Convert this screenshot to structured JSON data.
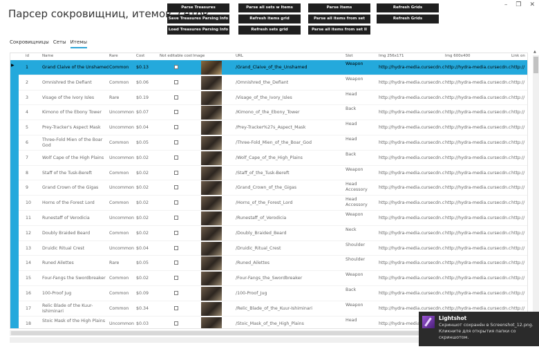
{
  "window": {
    "title": "Парсер сокровищниц, итемов, сетов",
    "min": "–",
    "max": "❐",
    "close": "✕"
  },
  "buttons": {
    "parse_treasures": "Parse Treasures",
    "save_treasures": "Save Treasures Parsing Info",
    "load_treasures": "Load Treasures Parsing Info",
    "parse_sets": "Parse all sets w Items",
    "refresh_items": "Refresh items grid",
    "refresh_sets": "Refresh sets grid",
    "parse_items": "Parse Items",
    "parse_all_from_set": "Parse all items from set",
    "parse_all_from_set2": "Parse all items from set II",
    "refresh_grids": "Refresh Grids",
    "refresh_grids2": "Refresh Grids"
  },
  "tabs": [
    "Сокровищницы",
    "Сеты",
    "Итемы"
  ],
  "columns": [
    "id",
    "Name",
    "Rare",
    "Cost",
    "Not editable cost",
    "Image",
    "URL",
    "Slot",
    "Img 256x171",
    "Img 600x400",
    "Link on"
  ],
  "rows": [
    {
      "id": "1",
      "name": "Grand Claive of the Unshamed",
      "rare": "Common",
      "cost": "$0.13",
      "url": "/Grand_Claive_of_the_Unshamed",
      "slot": "Weapon",
      "img256": "http://hydra-media.cursecdn.com",
      "img600": "http://hydra-media.cursecdn.com",
      "link": "http://"
    },
    {
      "id": "2",
      "name": "Omnishred the Defiant",
      "rare": "Common",
      "cost": "$0.06",
      "url": "/Omnishred_the_Defiant",
      "slot": "Weapon",
      "img256": "http://hydra-media.cursecdn.cor",
      "img600": "http://hydra-media.cursecdn.cor",
      "link": "http://"
    },
    {
      "id": "3",
      "name": "Visage of the Ivory Isles",
      "rare": "Rare",
      "cost": "$0.19",
      "url": "/Visage_of_the_Ivory_Isles",
      "slot": "Head",
      "img256": "http://hydra-media.cursecdn.cor",
      "img600": "http://hydra-media.cursecdn.cor",
      "link": "http://"
    },
    {
      "id": "4",
      "name": "Kimono of the Ebony Tower",
      "rare": "Uncommon",
      "cost": "$0.07",
      "url": "/Kimono_of_the_Ebony_Tower",
      "slot": "Back",
      "img256": "http://hydra-media.cursecdn.cor",
      "img600": "http://hydra-media.cursecdn.cor",
      "link": "http://"
    },
    {
      "id": "5",
      "name": "Prey-Tracker's Aspect Mask",
      "rare": "Uncommon",
      "cost": "$0.04",
      "url": "/Prey-Tracker%27s_Aspect_Mask",
      "slot": "Head",
      "img256": "http://hydra-media.cursecdn.cor",
      "img600": "http://hydra-media.cursecdn.cor",
      "link": "http://"
    },
    {
      "id": "6",
      "name": "Three-Fold Mien of the Boar God",
      "rare": "Common",
      "cost": "$0.05",
      "url": "/Three-Fold_Mien_of_the_Boar_God",
      "slot": "Head",
      "img256": "http://hydra-media.cursecdn.cor",
      "img600": "http://hydra-media.cursecdn.cor",
      "link": "http://"
    },
    {
      "id": "7",
      "name": "Wolf Cape of the High Plains",
      "rare": "Uncommon",
      "cost": "$0.02",
      "url": "/Wolf_Cape_of_the_High_Plains",
      "slot": "Back",
      "img256": "http://hydra-media.cursecdn.cor",
      "img600": "http://hydra-media.cursecdn.cor",
      "link": "http://"
    },
    {
      "id": "8",
      "name": "Staff of the Tusk-Bereft",
      "rare": "Common",
      "cost": "$0.02",
      "url": "/Staff_of_the_Tusk-Bereft",
      "slot": "Weapon",
      "img256": "http://hydra-media.cursecdn.cor",
      "img600": "http://hydra-media.cursecdn.cor",
      "link": "http://"
    },
    {
      "id": "9",
      "name": "Grand Crown of the Gigas",
      "rare": "Uncommon",
      "cost": "$0.02",
      "url": "/Grand_Crown_of_the_Gigas",
      "slot": "Head Accessory",
      "img256": "http://hydra-media.cursecdn.cor",
      "img600": "http://hydra-media.cursecdn.cor",
      "link": "http://"
    },
    {
      "id": "10",
      "name": "Horns of the Forest Lord",
      "rare": "Common",
      "cost": "$0.02",
      "url": "/Horns_of_the_Forest_Lord",
      "slot": "Head Accessory",
      "img256": "http://hydra-media.cursecdn.cor",
      "img600": "http://hydra-media.cursecdn.cor",
      "link": "http://"
    },
    {
      "id": "11",
      "name": "Runestaff of Verodicia",
      "rare": "Uncommon",
      "cost": "$0.02",
      "url": "/Runestaff_of_Verodicia",
      "slot": "Weapon",
      "img256": "http://hydra-media.cursecdn.cor",
      "img600": "http://hydra-media.cursecdn.cor",
      "link": "http://"
    },
    {
      "id": "12",
      "name": "Doubly Braided Beard",
      "rare": "Common",
      "cost": "$0.02",
      "url": "/Doubly_Braided_Beard",
      "slot": "Neck",
      "img256": "http://hydra-media.cursecdn.cor",
      "img600": "http://hydra-media.cursecdn.cor",
      "link": "http://"
    },
    {
      "id": "13",
      "name": "Druidic Ritual Crest",
      "rare": "Uncommon",
      "cost": "$0.04",
      "url": "/Druidic_Ritual_Crest",
      "slot": "Shoulder",
      "img256": "http://hydra-media.cursecdn.cor",
      "img600": "http://hydra-media.cursecdn.cor",
      "link": "http://"
    },
    {
      "id": "14",
      "name": "Runed Ailettes",
      "rare": "Rare",
      "cost": "$0.05",
      "url": "/Runed_Ailettes",
      "slot": "Shoulder",
      "img256": "http://hydra-media.cursecdn.cor",
      "img600": "http://hydra-media.cursecdn.cor",
      "link": "http://"
    },
    {
      "id": "15",
      "name": "Four-Fangs the Swordbreaker",
      "rare": "Common",
      "cost": "$0.02",
      "url": "/Four-Fangs_the_Swordbreaker",
      "slot": "Weapon",
      "img256": "http://hydra-media.cursecdn.cor",
      "img600": "http://hydra-media.cursecdn.cor",
      "link": "http://"
    },
    {
      "id": "16",
      "name": "100-Proof Jug",
      "rare": "Common",
      "cost": "$0.09",
      "url": "/100-Proof_Jug",
      "slot": "Back",
      "img256": "http://hydra-media.cursecdn.cor",
      "img600": "http://hydra-media.cursecdn.cor",
      "link": "http://"
    },
    {
      "id": "17",
      "name": "Relic Blade of the Kuur-Ishiminari",
      "rare": "Common",
      "cost": "$0.34",
      "url": "/Relic_Blade_of_the_Kuur-Ishiminari",
      "slot": "Weapon",
      "img256": "http://hydra-media.cursecdn.cor",
      "img600": "http://hydra-media.cursecdn.cor",
      "link": "http://"
    },
    {
      "id": "18",
      "name": "Stoic Mask of the High Plains",
      "rare": "Uncommon",
      "cost": "$0.03",
      "url": "/Stoic_Mask_of_the_High_Plains",
      "slot": "Head",
      "img256": "http://hydra-media.cursecdn.cor",
      "img600": "http://hydra-media.cursecdn.cor",
      "link": "http://"
    }
  ],
  "toast": {
    "title": "Lightshot",
    "body": "Скриншот сохранён в Screenshot_12.png. Кликните для открытия папки со скриншотом."
  }
}
